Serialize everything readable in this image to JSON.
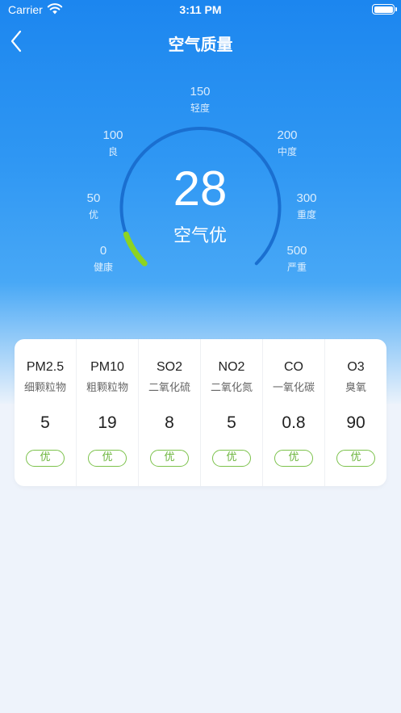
{
  "status_bar": {
    "carrier": "Carrier",
    "time": "3:11 PM"
  },
  "nav": {
    "title": "空气质量",
    "back_icon": "chevron-left-icon"
  },
  "gauge": {
    "aqi": "28",
    "status": "空气优",
    "max": 500,
    "ticks": [
      {
        "value": "0",
        "label": "健康"
      },
      {
        "value": "50",
        "label": "优"
      },
      {
        "value": "100",
        "label": "良"
      },
      {
        "value": "150",
        "label": "轻度"
      },
      {
        "value": "200",
        "label": "中度"
      },
      {
        "value": "300",
        "label": "重度"
      },
      {
        "value": "500",
        "label": "严重"
      }
    ],
    "colors": {
      "track": "#1a6fd0",
      "progress": "#8ed321"
    }
  },
  "pollutants": [
    {
      "code": "PM2.5",
      "name": "细颗粒物",
      "value": "5",
      "level": "优"
    },
    {
      "code": "PM10",
      "name": "粗颗粒物",
      "value": "19",
      "level": "优"
    },
    {
      "code": "SO2",
      "name": "二氧化硫",
      "value": "8",
      "level": "优"
    },
    {
      "code": "NO2",
      "name": "二氧化氮",
      "value": "5",
      "level": "优"
    },
    {
      "code": "CO",
      "name": "一氧化碳",
      "value": "0.8",
      "level": "优"
    },
    {
      "code": "O3",
      "name": "臭氧",
      "value": "90",
      "level": "优"
    }
  ],
  "colors": {
    "accent": "#2d95f2",
    "good": "#7cc24b"
  }
}
